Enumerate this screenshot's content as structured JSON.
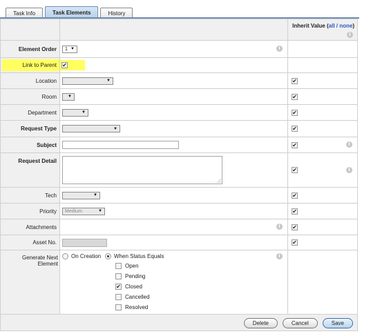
{
  "tabs": [
    {
      "label": "Task Info",
      "active": false
    },
    {
      "label": "Task Elements",
      "active": true
    },
    {
      "label": "History",
      "active": false
    }
  ],
  "header": {
    "inherit_label": "Inherit Value (",
    "all": "all",
    "sep": " / ",
    "none": "none",
    "close": ")"
  },
  "rows": {
    "element_order": {
      "label": "Element Order",
      "value": "1"
    },
    "link_to_parent": {
      "label": "Link to Parent",
      "checked": true
    },
    "location": {
      "label": "Location",
      "value": ""
    },
    "room": {
      "label": "Room",
      "value": ""
    },
    "department": {
      "label": "Department",
      "value": ""
    },
    "request_type": {
      "label": "Request Type",
      "value": ""
    },
    "subject": {
      "label": "Subject",
      "value": ""
    },
    "request_detail": {
      "label": "Request Detail",
      "value": ""
    },
    "tech": {
      "label": "Tech",
      "value": ""
    },
    "priority": {
      "label": "Priority",
      "value": "Medium"
    },
    "attachments": {
      "label": "Attachments"
    },
    "asset_no": {
      "label": "Asset No.",
      "value": ""
    },
    "generate_next": {
      "label": "Generate Next Element",
      "on_creation": "On Creation",
      "when_status": "When Status Equals",
      "statuses": [
        {
          "label": "Open",
          "checked": false
        },
        {
          "label": "Pending",
          "checked": false
        },
        {
          "label": "Closed",
          "checked": true
        },
        {
          "label": "Cancelled",
          "checked": false
        },
        {
          "label": "Resolved",
          "checked": false
        }
      ]
    }
  },
  "buttons": {
    "delete": "Delete",
    "cancel": "Cancel",
    "save": "Save"
  },
  "colors": {
    "tab_active": "#b9d1ea",
    "highlight": "#ffff60",
    "link": "#2a56c6"
  }
}
